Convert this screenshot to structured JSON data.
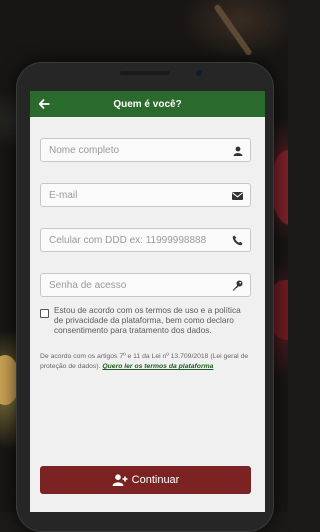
{
  "header": {
    "title": "Quem é você?"
  },
  "form": {
    "name_placeholder": "Nome completo",
    "email_placeholder": "E-mail",
    "phone_placeholder": "Celular com DDD ex: 11999998888",
    "password_placeholder": "Senha de acesso"
  },
  "terms": {
    "checked": false,
    "text": "Estou de acordo com os termos de uso e a política de privacidade da plataforma, bem como declaro consentimento para tratamento dos dados."
  },
  "law": {
    "text": "De acordo com os artigos 7º e 11 da Lei nº 13.709/2018 (Lei geral de proteção de dados). ",
    "link": "Quero ler os termos da plataforma"
  },
  "actions": {
    "continue_label": "Continuar"
  },
  "icons": {
    "back": "arrow-left-icon",
    "name": "user-icon",
    "email": "envelope-icon",
    "phone": "phone-icon",
    "password": "key-icon",
    "continue": "user-plus-icon"
  },
  "colors": {
    "header": "#2b6a2d",
    "button": "#7b2323",
    "link": "#1e5d1f"
  }
}
